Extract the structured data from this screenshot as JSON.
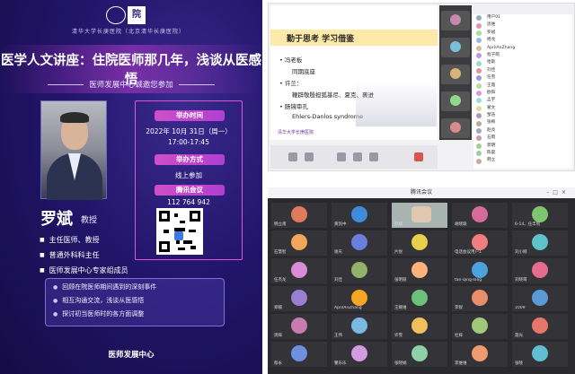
{
  "poster": {
    "university": "清华大学长庚医院（北京清华长庚医院）",
    "title": "医学人文讲座：住院医师那几年，浅谈从医感悟",
    "invite": "医师发展中心诚邀您参加",
    "speaker": {
      "name": "罗斌",
      "rank": "教授"
    },
    "bullets": [
      "主任医师、教授",
      "普通外科科主任",
      "医师发展中心专家组成员"
    ],
    "info": [
      {
        "tag": "举办时间",
        "lines": [
          "2022年 10月 31日（周一）",
          "17:00-17:45"
        ]
      },
      {
        "tag": "举办方式",
        "lines": [
          "线上参加"
        ]
      },
      {
        "tag": "腾讯会议",
        "lines": [
          "112 764 942"
        ]
      }
    ],
    "topics": [
      "回顾在院医师期间遇到的深刻事件",
      "相互沟通交流，浅谈从医感悟",
      "探讨初当医师时的各方面调整"
    ],
    "footer": "医师发展中心"
  },
  "meeting_slide": {
    "heading": "勤于思考 学习借鉴",
    "items": [
      {
        "main": "冯老板",
        "sub": "同期底座"
      },
      {
        "main": "许兰：",
        "sub": "鞭辟敬殷担狐基尼、夏克、裹进"
      },
      {
        "main": "肠镜审孔",
        "sub": "Ehlers-Danlos syndrome"
      }
    ],
    "footer": "清华大学长庚医院"
  },
  "participant_list": [
    "用户01",
    "思维",
    "罗斌",
    "杨戈",
    "AprilAnZhang",
    "程子萌",
    "哈斯",
    "刘佳",
    "任雪",
    "王霞",
    "欧阳",
    "孟宇",
    "翟文",
    "邹浩",
    "张梅",
    "赵亮",
    "石雨",
    "郭明",
    "陈晨",
    "韩立"
  ],
  "meeting_window": {
    "title": "腾讯会议",
    "tiles": [
      {
        "name": "韩立南",
        "color": "#e07a5f"
      },
      {
        "name": "黄凯中",
        "color": "#3d8bd9"
      },
      {
        "name": "罗斌",
        "color": "#e0c8b0",
        "video": true
      },
      {
        "name": "胡晓瑜",
        "color": "#d66a9a"
      },
      {
        "name": "6-14、任丰钊",
        "color": "#7fc46e"
      },
      {
        "name": "石慧智",
        "color": "#f2a65a"
      },
      {
        "name": "谢天",
        "color": "#6a7fdb"
      },
      {
        "name": "片悦",
        "color": "#e8d14a"
      },
      {
        "name": "电话会议用户1",
        "color": "#f07e7e"
      },
      {
        "name": "刘小刚",
        "color": "#5ec2c9"
      },
      {
        "name": "任杰龙",
        "color": "#d98ad9"
      },
      {
        "name": "刘佳",
        "color": "#8fb36b"
      },
      {
        "name": "张明丽",
        "color": "#ffb37a"
      },
      {
        "name": "tan-qing-long",
        "color": "#4aa3df"
      },
      {
        "name": "刘晓萌",
        "color": "#e56b8f"
      },
      {
        "name": "郑楠",
        "color": "#9a7fd1"
      },
      {
        "name": "AprilAnZhang",
        "color": "#f5a623"
      },
      {
        "name": "王耀维",
        "color": "#6cc07c"
      },
      {
        "name": "李锐",
        "color": "#e88f6a"
      },
      {
        "name": "1009",
        "color": "#5b9bd5"
      },
      {
        "name": "周辉",
        "color": "#c97bb0"
      },
      {
        "name": "王伟",
        "color": "#7ab8e0"
      },
      {
        "name": "许雪",
        "color": "#f0c05a"
      },
      {
        "name": "杜梓",
        "color": "#a0c878"
      },
      {
        "name": "聂光",
        "color": "#e8756a"
      },
      {
        "name": "蔡永",
        "color": "#6f8fe0"
      },
      {
        "name": "瞿乐乐",
        "color": "#d49adf"
      },
      {
        "name": "张晓娟",
        "color": "#8cd1a8"
      },
      {
        "name": "李维维",
        "color": "#f29a6f"
      },
      {
        "name": "张晓",
        "color": "#5fbfd0"
      }
    ]
  }
}
